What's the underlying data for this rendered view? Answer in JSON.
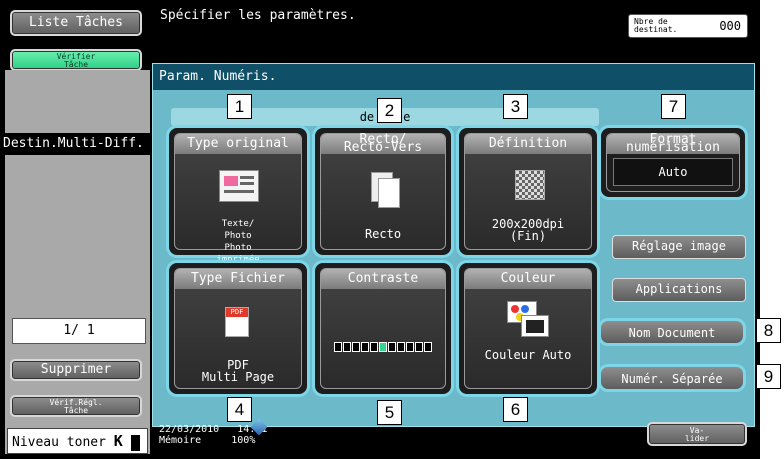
{
  "sidebar": {
    "list_tasks": "Liste Tâches",
    "verify_task": [
      "Vérifier",
      "Tâche"
    ],
    "multi_dest": "Destin.Multi-Diff.",
    "page_counter": "1/  1",
    "delete": "Supprimer",
    "verify_settings": [
      "Vérif.Régl.",
      "Tâche"
    ],
    "toner_label": "Niveau toner",
    "toner_glyph": "K"
  },
  "header": {
    "instruction": "Spécifier les paramètres.",
    "dest_label": [
      "Nbre de",
      "destinat."
    ],
    "dest_count": "000"
  },
  "panel": {
    "title": "Param. Numéris.",
    "section_label": "de",
    "section_label_tail": "e"
  },
  "buttons": {
    "type_original": {
      "title": "Type original",
      "value": [
        "Texte/",
        "Photo",
        "Photo",
        "imprimée"
      ]
    },
    "recto_verso": {
      "title": [
        "Recto/",
        "Recto-Vers"
      ],
      "value": "Recto"
    },
    "definition": {
      "title": "Définition",
      "value": [
        "200x200dpi",
        "(Fin)"
      ]
    },
    "type_fichier": {
      "title": "Type Fichier",
      "icon_text": "PDF",
      "value": [
        "PDF",
        "Multi Page"
      ]
    },
    "contraste": {
      "title": "Contraste",
      "level_fraction": 0.5,
      "segments": 11,
      "active_segment": 6
    },
    "couleur": {
      "title": "Couleur",
      "value": "Couleur Auto"
    },
    "format_num": {
      "title": [
        "Format",
        "numérisation"
      ],
      "value": "Auto"
    },
    "reglage_image": "Réglage image",
    "applications": "Applications",
    "nom_document": "Nom Document",
    "numer_separee": "Numér. Séparée",
    "valider": [
      "Va-",
      "lider"
    ]
  },
  "status": {
    "date": "22/03/2010",
    "time": "14:11",
    "memory_label": "Mémoire",
    "memory_value": "100%"
  },
  "callouts": [
    "1",
    "2",
    "3",
    "4",
    "5",
    "6",
    "7",
    "8",
    "9"
  ],
  "colors": {
    "accent": "#7dd6e8",
    "panel_title_bg": "#0f4f67",
    "panel_bg": "#6bb9c9",
    "green": "#35d48c"
  }
}
